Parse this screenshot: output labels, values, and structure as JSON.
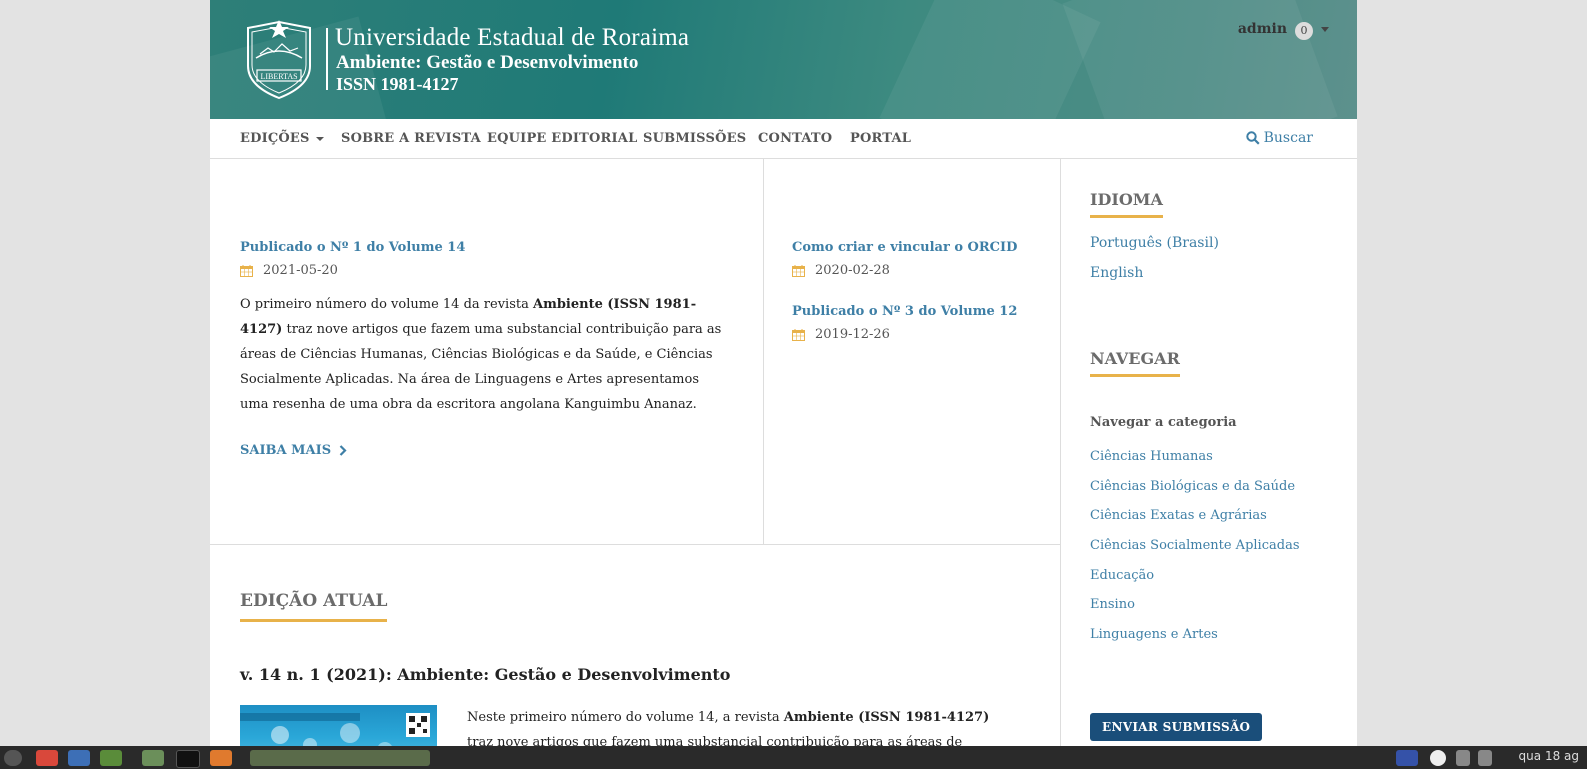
{
  "header": {
    "university": "Universidade Estadual de Roraima",
    "journal": "Ambiente: Gestão e Desenvolvimento",
    "issn": "ISSN 1981-4127",
    "seal_text": "LIBERTAS",
    "user": {
      "name": "admin",
      "notifications": "0"
    }
  },
  "nav": {
    "items": [
      "EDIÇÕES",
      "SOBRE A REVISTA",
      "EQUIPE EDITORIAL",
      "SUBMISSÕES",
      "CONTATO",
      "PORTAL"
    ],
    "search_label": "Buscar"
  },
  "announcements": {
    "featured": {
      "title": "Publicado o Nº 1 do Volume 14",
      "date": "2021-05-20",
      "summary_lead": "O primeiro número do volume 14 da revista ",
      "summary_bold": "Ambiente (ISSN 1981-4127)",
      "summary_rest": " traz nove artigos que fazem uma substancial contribuição para as áreas de Ciências Humanas, Ciências Biológicas e da Saúde, e Ciências Socialmente Aplicadas. Na área de Linguagens e Artes apresentamos uma resenha de uma obra da escritora angolana Kanguimbu Ananaz.",
      "read_more": "SAIBA MAIS"
    },
    "others": [
      {
        "title": "Como criar e vincular o ORCID",
        "date": "2020-02-28"
      },
      {
        "title": "Publicado o Nº 3 do Volume 12",
        "date": "2019-12-26"
      }
    ]
  },
  "current_issue": {
    "heading": "EDIÇÃO ATUAL",
    "title": "v. 14 n. 1 (2021): Ambiente: Gestão e Desenvolvimento",
    "desc_lead": "Neste primeiro número do volume 14, a revista ",
    "desc_bold": "Ambiente (ISSN 1981-4127)",
    "desc_rest": " traz nove artigos que fazem uma substancial contribuição para as áreas de Ciências"
  },
  "sidebar": {
    "language_heading": "IDIOMA",
    "languages": [
      "Português (Brasil)",
      "English"
    ],
    "browse_heading": "NAVEGAR",
    "browse_sub": "Navegar a categoria",
    "categories": [
      "Ciências Humanas",
      "Ciências Biológicas e da Saúde",
      "Ciências Exatas e Agrárias",
      "Ciências Socialmente Aplicadas",
      "Educação",
      "Ensino",
      "Linguagens e Artes"
    ],
    "submit_button": "ENVIAR SUBMISSÃO"
  },
  "taskbar": {
    "clock": "qua 18 ag"
  },
  "colors": {
    "accent": "#e8b24a",
    "link": "#3e7fa6",
    "header": "#2e7f78",
    "button": "#1a4e7a"
  }
}
